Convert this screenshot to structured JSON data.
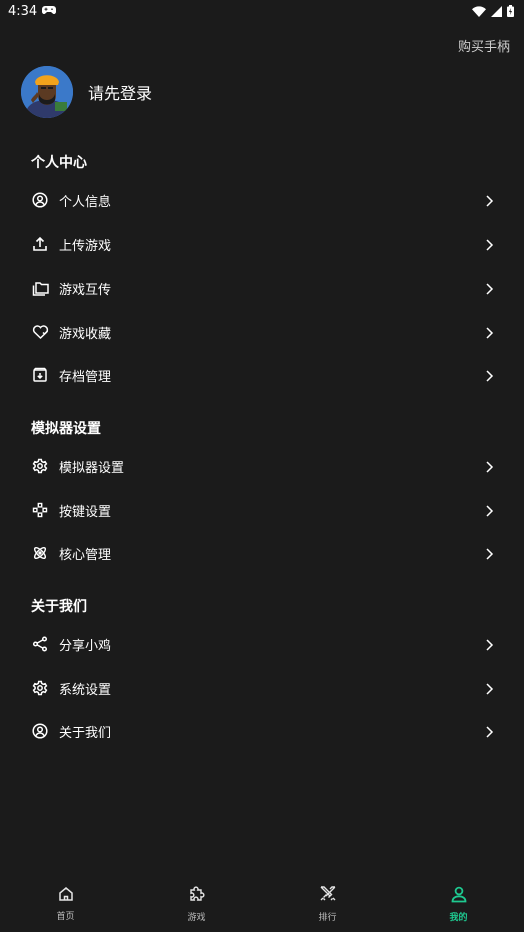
{
  "status_bar": {
    "time": "4:34"
  },
  "header": {
    "buy_controller": "购买手柄"
  },
  "profile": {
    "login_prompt": "请先登录"
  },
  "sections": [
    {
      "title": "个人中心",
      "items": [
        {
          "label": "个人信息",
          "icon": "user-circle-icon"
        },
        {
          "label": "上传游戏",
          "icon": "upload-icon"
        },
        {
          "label": "游戏互传",
          "icon": "folders-icon"
        },
        {
          "label": "游戏收藏",
          "icon": "heart-icon"
        },
        {
          "label": "存档管理",
          "icon": "archive-icon"
        }
      ]
    },
    {
      "title": "模拟器设置",
      "items": [
        {
          "label": "模拟器设置",
          "icon": "gear-icon"
        },
        {
          "label": "按键设置",
          "icon": "gamepad-keys-icon"
        },
        {
          "label": "核心管理",
          "icon": "atom-icon"
        }
      ]
    },
    {
      "title": "关于我们",
      "items": [
        {
          "label": "分享小鸡",
          "icon": "share-icon"
        },
        {
          "label": "系统设置",
          "icon": "gear-icon"
        },
        {
          "label": "关于我们",
          "icon": "user-circle-icon"
        }
      ]
    }
  ],
  "bottom_nav": [
    {
      "label": "首页",
      "icon": "home-icon",
      "active": false
    },
    {
      "label": "游戏",
      "icon": "puzzle-icon",
      "active": false
    },
    {
      "label": "排行",
      "icon": "swords-icon",
      "active": false
    },
    {
      "label": "我的",
      "icon": "person-icon",
      "active": true
    }
  ],
  "colors": {
    "background": "#1b1b1b",
    "accent": "#1ec990",
    "text": "#ffffff"
  }
}
